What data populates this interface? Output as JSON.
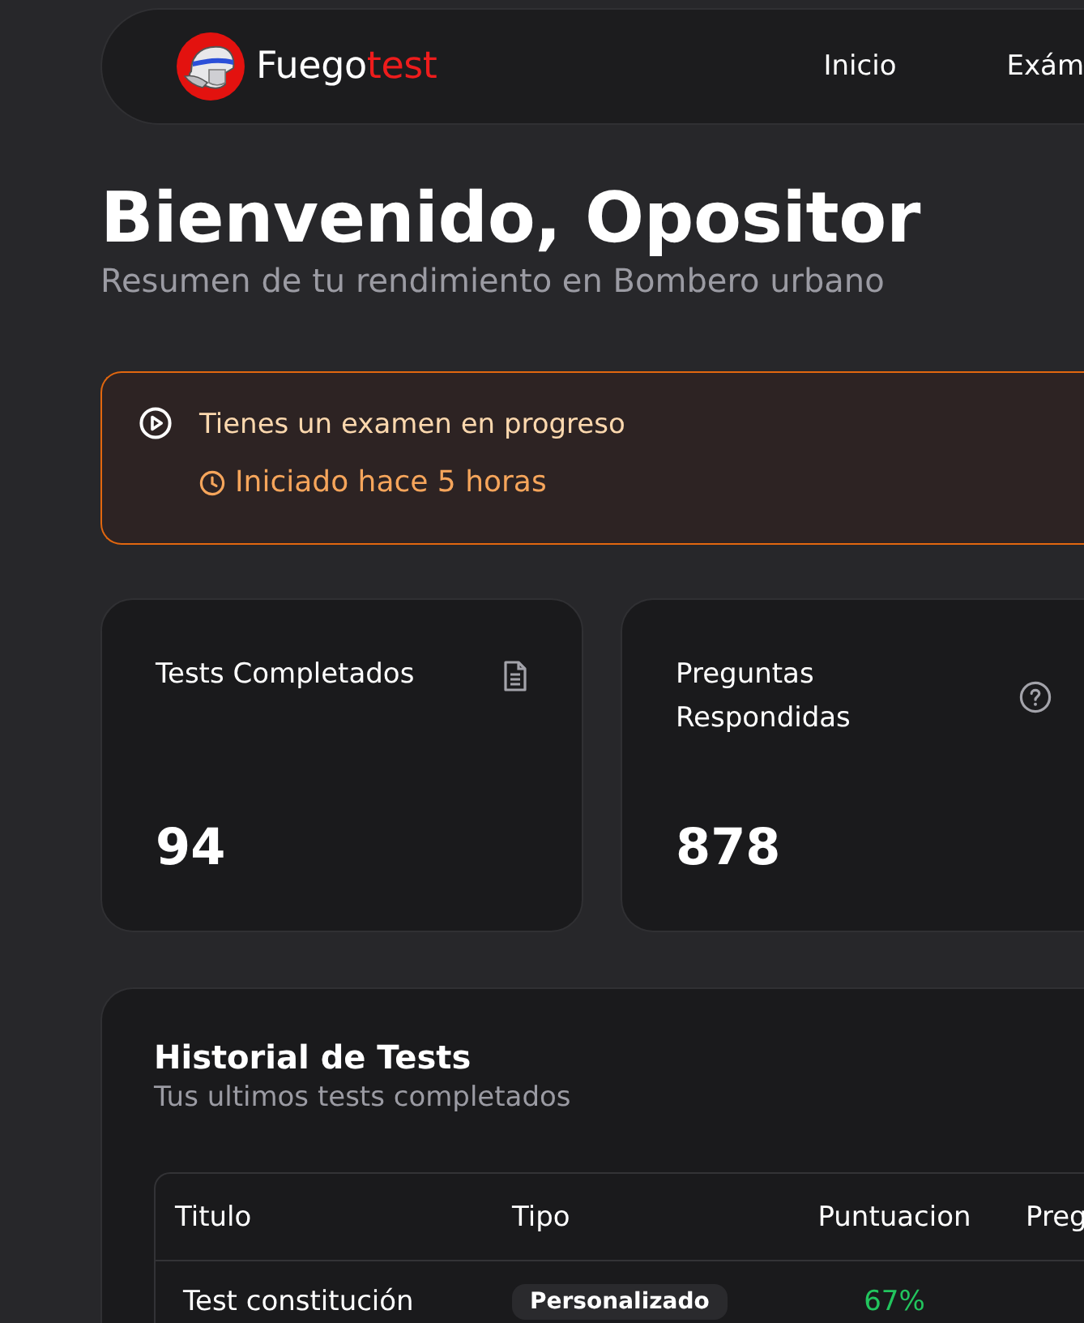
{
  "header": {
    "logo": {
      "text": "Fuego",
      "accent": "test"
    },
    "nav": [
      {
        "label": "Inicio"
      },
      {
        "label": "Exám"
      }
    ]
  },
  "welcome": {
    "title": "Bienvenido, Opositor",
    "subtitle": "Resumen de tu rendimiento en Bombero urbano"
  },
  "alert": {
    "title": "Tienes un examen en progreso",
    "detail": "Iniciado hace 5 horas"
  },
  "stats": [
    {
      "label": "Tests Completados",
      "value": "94"
    },
    {
      "label": "Preguntas Respondidas",
      "value": "878"
    }
  ],
  "history": {
    "title": "Historial de Tests",
    "subtitle": "Tus ultimos tests completados",
    "table": {
      "columns": [
        "Titulo",
        "Tipo",
        "Puntuacion",
        "Preg"
      ],
      "rows": [
        {
          "title": "Test constitución",
          "type": "Personalizado",
          "score": "67%"
        }
      ]
    }
  }
}
